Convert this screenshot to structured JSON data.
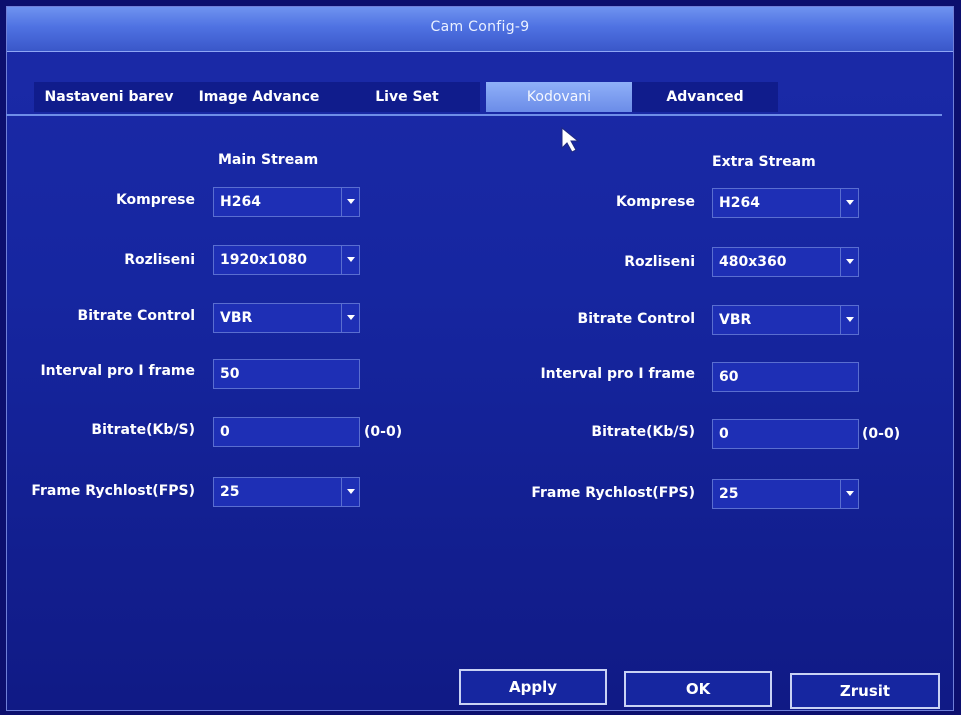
{
  "window": {
    "title": "Cam Config-9"
  },
  "tabs": [
    {
      "label": "Nastaveni barev"
    },
    {
      "label": "Image Advance"
    },
    {
      "label": "Live Set"
    },
    {
      "label": "Kodovani",
      "active": true
    },
    {
      "label": "Advanced"
    }
  ],
  "main": {
    "heading": "Main Stream",
    "labels": {
      "compression": "Komprese",
      "resolution": "Rozliseni",
      "bitrate_control": "Bitrate Control",
      "iframe_interval": "Interval pro I frame",
      "bitrate": "Bitrate(Kb/S)",
      "fps": "Frame Rychlost(FPS)"
    },
    "values": {
      "compression": "H264",
      "resolution": "1920x1080",
      "bitrate_control": "VBR",
      "iframe_interval": "50",
      "bitrate": "0",
      "bitrate_range": "(0-0)",
      "fps": "25"
    }
  },
  "extra": {
    "heading": "Extra Stream",
    "labels": {
      "compression": "Komprese",
      "resolution": "Rozliseni",
      "bitrate_control": "Bitrate Control",
      "iframe_interval": "Interval pro I frame",
      "bitrate": "Bitrate(Kb/S)",
      "fps": "Frame Rychlost(FPS)"
    },
    "values": {
      "compression": "H264",
      "resolution": "480x360",
      "bitrate_control": "VBR",
      "iframe_interval": "60",
      "bitrate": "0",
      "bitrate_range": "(0-0)",
      "fps": "25"
    }
  },
  "buttons": {
    "apply": "Apply",
    "ok": "OK",
    "cancel": "Zrusit"
  },
  "colors": {
    "background": "#1626a0",
    "titlebar": "#4f72e2",
    "active_tab": "#7a9af0",
    "field": "#1e2fb5"
  },
  "icons": {
    "cursor": "mouse-pointer-icon",
    "dropdown": "chevron-down-icon"
  }
}
